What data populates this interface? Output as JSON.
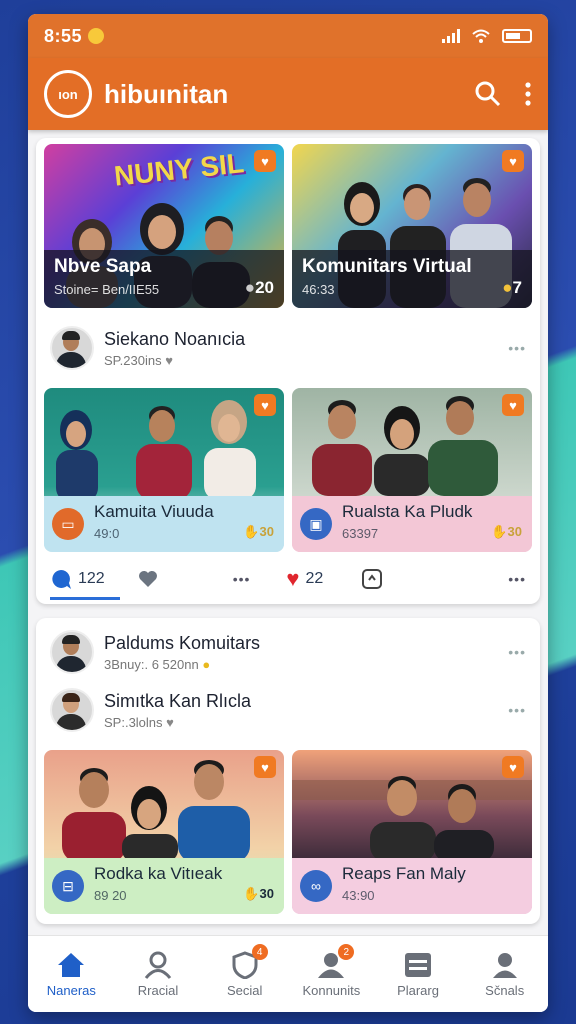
{
  "status": {
    "time": "8:55"
  },
  "app": {
    "logo_text": "ıon",
    "title": "hibuınitan"
  },
  "feed": {
    "top_tiles": [
      {
        "title": "Nbve Sapa",
        "subtitle": "Stoine= Ben/IIE55",
        "count": "20",
        "banner": "NUNY SIL"
      },
      {
        "title": "Komunitars Virtual",
        "subtitle": "46:33",
        "count": "7"
      }
    ],
    "post1": {
      "user": {
        "name": "Siekano Noanıcia",
        "meta": "SP.230ins"
      },
      "tiles": [
        {
          "title": "Kamuita Viuuda",
          "subtitle": "49:0",
          "count": "30",
          "color": "#bfe3f0"
        },
        {
          "title": "Rualsta Ka Pludk",
          "subtitle": "63397",
          "count": "30",
          "color": "#f3c7d6"
        }
      ],
      "actions": {
        "comments": "122",
        "likes": "22"
      }
    },
    "post2": {
      "user1": {
        "name": "Paldums Komuitars",
        "meta": "3Bnuy:. 6 520nn"
      },
      "user2": {
        "name": "Simıtka Kan Rlıcla",
        "meta": "SP:.3lolns"
      },
      "tiles": [
        {
          "title": "Rodka ka Vitıeak",
          "subtitle": "89 20",
          "count": "30",
          "color": "#cdeec3"
        },
        {
          "title": "Reaps Fan Maly",
          "subtitle": "43:90",
          "count": "",
          "color": "#f4cde0"
        }
      ]
    }
  },
  "nav": [
    {
      "label": "Naneras",
      "icon": "home-icon"
    },
    {
      "label": "Rracial",
      "icon": "person-icon"
    },
    {
      "label": "Secial",
      "icon": "shield-icon",
      "badge": "4"
    },
    {
      "label": "Konnunits",
      "icon": "community-icon",
      "badge": "2"
    },
    {
      "label": "Plararg",
      "icon": "list-icon"
    },
    {
      "label": "Sčnals",
      "icon": "profile-icon"
    }
  ]
}
